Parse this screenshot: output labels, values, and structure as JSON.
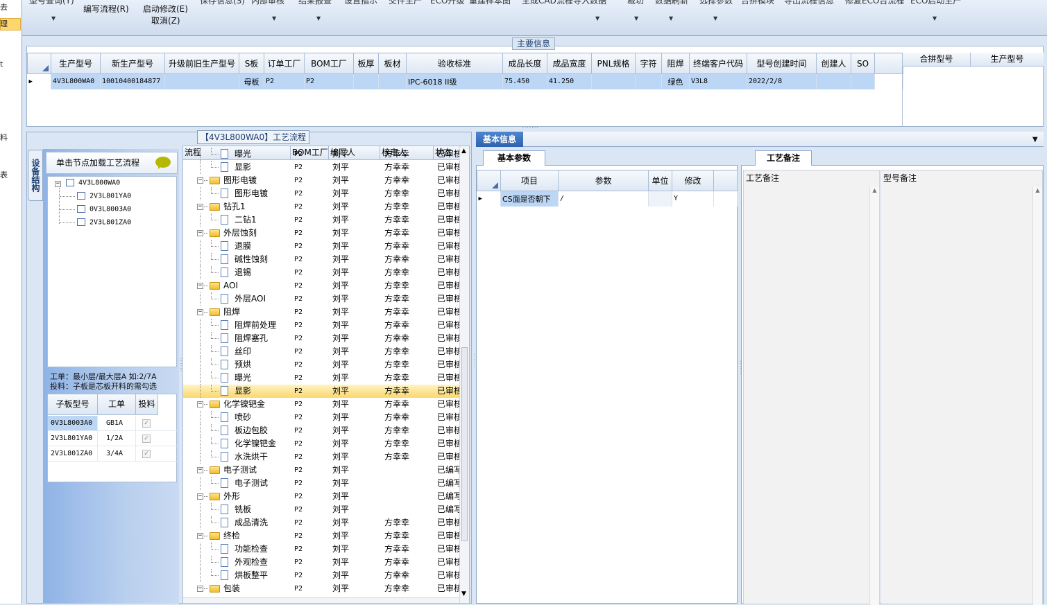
{
  "left_strip": {
    "items": [
      "去",
      "理",
      "t",
      "料",
      "表"
    ]
  },
  "toolbar": {
    "faded_row": [
      "型号查询(Y)",
      "保存信息(S)",
      "内部审核",
      "结果报查",
      "设置指示",
      "交件生产",
      "ECO升级",
      "重建样本图",
      "生成CAD流程",
      "导入数据",
      "裁切",
      "数据刷新",
      "选择参数",
      "合拼模块",
      "导出流程信息",
      "修复ECO台流程",
      "ECO启动生产"
    ],
    "write_flow": "编写流程(R)",
    "start_modify": "启动修改(E)",
    "cancel": "取消(Z)"
  },
  "main_info": {
    "title": "主要信息",
    "columns": [
      "生产型号",
      "新生产型号",
      "升级前旧生产型号",
      "S板",
      "订单工厂",
      "BOM工厂",
      "板厚",
      "板材",
      "验收标准",
      "成品长度",
      "成品宽度",
      "PNL规格",
      "字符",
      "阻焊",
      "终端客户代码",
      "型号创建时间",
      "创建人",
      "SO"
    ],
    "row": [
      "4V3L800WA0",
      "10010400184877",
      "",
      "母板",
      "P2",
      "P2",
      "",
      "",
      "IPC-6018 II级",
      "75.450",
      "41.250",
      "",
      "",
      "绿色",
      "V3L8",
      "2022/2/8",
      "",
      ""
    ],
    "merge_columns": [
      "合拼型号",
      "生产型号"
    ]
  },
  "flow": {
    "caption": "【4V3L800WA0】工艺流程",
    "columns": [
      "流程",
      "BOM工厂",
      "编写人",
      "核审人",
      "状态"
    ],
    "rows": [
      {
        "name": "曝光",
        "level": 1,
        "bom": "P2",
        "writer": "刘平",
        "reviewer": "方幸幸",
        "status": "已审核"
      },
      {
        "name": "显影",
        "level": 1,
        "bom": "P2",
        "writer": "刘平",
        "reviewer": "方幸幸",
        "status": "已审核"
      },
      {
        "name": "图形电镀",
        "level": 0,
        "bom": "P2",
        "writer": "刘平",
        "reviewer": "方幸幸",
        "status": "已审核"
      },
      {
        "name": "图形电镀",
        "level": 1,
        "bom": "P2",
        "writer": "刘平",
        "reviewer": "方幸幸",
        "status": "已审核"
      },
      {
        "name": "钻孔1",
        "level": 0,
        "bom": "P2",
        "writer": "刘平",
        "reviewer": "方幸幸",
        "status": "已审核"
      },
      {
        "name": "二钻1",
        "level": 1,
        "bom": "P2",
        "writer": "刘平",
        "reviewer": "方幸幸",
        "status": "已审核"
      },
      {
        "name": "外层蚀刻",
        "level": 0,
        "bom": "P2",
        "writer": "刘平",
        "reviewer": "方幸幸",
        "status": "已审核"
      },
      {
        "name": "退膜",
        "level": 1,
        "bom": "P2",
        "writer": "刘平",
        "reviewer": "方幸幸",
        "status": "已审核"
      },
      {
        "name": "碱性蚀刻",
        "level": 1,
        "bom": "P2",
        "writer": "刘平",
        "reviewer": "方幸幸",
        "status": "已审核"
      },
      {
        "name": "退锡",
        "level": 1,
        "bom": "P2",
        "writer": "刘平",
        "reviewer": "方幸幸",
        "status": "已审核"
      },
      {
        "name": "AOI",
        "level": 0,
        "bom": "P2",
        "writer": "刘平",
        "reviewer": "方幸幸",
        "status": "已审核"
      },
      {
        "name": "外层AOI",
        "level": 1,
        "bom": "P2",
        "writer": "刘平",
        "reviewer": "方幸幸",
        "status": "已审核"
      },
      {
        "name": "阻焊",
        "level": 0,
        "bom": "P2",
        "writer": "刘平",
        "reviewer": "方幸幸",
        "status": "已审核"
      },
      {
        "name": "阻焊前处理",
        "level": 1,
        "bom": "P2",
        "writer": "刘平",
        "reviewer": "方幸幸",
        "status": "已审核"
      },
      {
        "name": "阻焊塞孔",
        "level": 1,
        "bom": "P2",
        "writer": "刘平",
        "reviewer": "方幸幸",
        "status": "已审核"
      },
      {
        "name": "丝印",
        "level": 1,
        "bom": "P2",
        "writer": "刘平",
        "reviewer": "方幸幸",
        "status": "已审核"
      },
      {
        "name": "预烘",
        "level": 1,
        "bom": "P2",
        "writer": "刘平",
        "reviewer": "方幸幸",
        "status": "已审核"
      },
      {
        "name": "曝光",
        "level": 1,
        "bom": "P2",
        "writer": "刘平",
        "reviewer": "方幸幸",
        "status": "已审核"
      },
      {
        "name": "显影",
        "level": 1,
        "bom": "P2",
        "writer": "刘平",
        "reviewer": "方幸幸",
        "status": "已审核",
        "selected": true
      },
      {
        "name": "化学镍钯金",
        "level": 0,
        "bom": "P2",
        "writer": "刘平",
        "reviewer": "方幸幸",
        "status": "已审核"
      },
      {
        "name": "喷砂",
        "level": 1,
        "bom": "P2",
        "writer": "刘平",
        "reviewer": "方幸幸",
        "status": "已审核"
      },
      {
        "name": "板边包胶",
        "level": 1,
        "bom": "P2",
        "writer": "刘平",
        "reviewer": "方幸幸",
        "status": "已审核"
      },
      {
        "name": "化学镍钯金",
        "level": 1,
        "bom": "P2",
        "writer": "刘平",
        "reviewer": "方幸幸",
        "status": "已审核"
      },
      {
        "name": "水洗烘干",
        "level": 1,
        "bom": "P2",
        "writer": "刘平",
        "reviewer": "方幸幸",
        "status": "已审核"
      },
      {
        "name": "电子测试",
        "level": 0,
        "bom": "P2",
        "writer": "刘平",
        "reviewer": "",
        "status": "已编写"
      },
      {
        "name": "电子测试",
        "level": 1,
        "bom": "P2",
        "writer": "刘平",
        "reviewer": "",
        "status": "已编写"
      },
      {
        "name": "外形",
        "level": 0,
        "bom": "P2",
        "writer": "刘平",
        "reviewer": "",
        "status": "已编写"
      },
      {
        "name": "铣板",
        "level": 1,
        "bom": "P2",
        "writer": "刘平",
        "reviewer": "",
        "status": "已编写"
      },
      {
        "name": "成品清洗",
        "level": 1,
        "bom": "P2",
        "writer": "刘平",
        "reviewer": "方幸幸",
        "status": "已审核"
      },
      {
        "name": "终检",
        "level": 0,
        "bom": "P2",
        "writer": "刘平",
        "reviewer": "方幸幸",
        "status": "已审核"
      },
      {
        "name": "功能检查",
        "level": 1,
        "bom": "P2",
        "writer": "刘平",
        "reviewer": "方幸幸",
        "status": "已审核"
      },
      {
        "name": "外观检查",
        "level": 1,
        "bom": "P2",
        "writer": "刘平",
        "reviewer": "方幸幸",
        "status": "已审核"
      },
      {
        "name": "烘板整平",
        "level": 1,
        "bom": "P2",
        "writer": "刘平",
        "reviewer": "方幸幸",
        "status": "已审核"
      },
      {
        "name": "包装",
        "level": 0,
        "bom": "P2",
        "writer": "刘平",
        "reviewer": "方幸幸",
        "status": "已审核"
      }
    ]
  },
  "structure": {
    "vtab": "设备结构",
    "header": "单击节点加载工艺流程",
    "root": "4V3L800WA0",
    "children": [
      "2V3L801YA0",
      "0V3L8003A0",
      "2V3L801ZA0"
    ],
    "note_line1": "工单：最小层/最大层A 如:2/7A",
    "note_line2": "投料：子板是芯板开料的需勾选",
    "sub_columns": [
      "子板型号",
      "工单",
      "投料"
    ],
    "sub_rows": [
      {
        "model": "0V3L8003A0",
        "order": "GB1A",
        "feed": true
      },
      {
        "model": "2V3L801YA0",
        "order": "1/2A",
        "feed": true
      },
      {
        "model": "2V3L801ZA0",
        "order": "3/4A",
        "feed": true
      }
    ]
  },
  "basic": {
    "tab": "基本信息",
    "params_tab": "基本参数",
    "params_columns": [
      "项目",
      "参数",
      "单位",
      "修改"
    ],
    "params_row": {
      "item": "CS面是否朝下",
      "param": "/",
      "unit": "",
      "modify": "Y"
    },
    "notes_tab": "工艺备注",
    "notes_columns": [
      "工艺备注",
      "型号备注"
    ]
  },
  "colors": {
    "accent": "#2d62b0",
    "selection": "#fbd76e",
    "row_highlight": "#bcd6f5"
  }
}
